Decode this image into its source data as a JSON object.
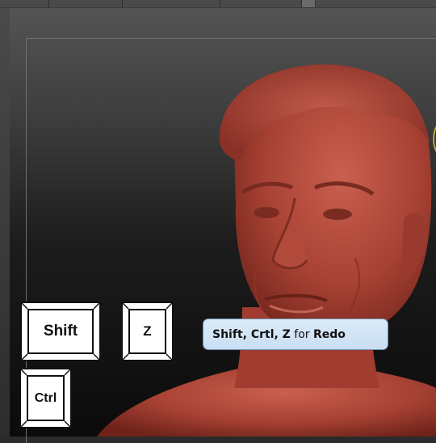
{
  "keys": {
    "shift": "Shift",
    "z": "Z",
    "ctrl": "Ctrl"
  },
  "tooltip": {
    "keys": "Shift, Crtl, Z",
    "for_word": "for",
    "action": "Redo"
  },
  "colors": {
    "sculpt_clay": "#b24a3c",
    "viewport_top": "#545454",
    "viewport_bottom": "#0b0b0b",
    "tooltip_bg": "#d4e5f6",
    "gizmo": "#b8a840"
  },
  "icons": {
    "gizmo": "axis-gizmo-icon"
  }
}
